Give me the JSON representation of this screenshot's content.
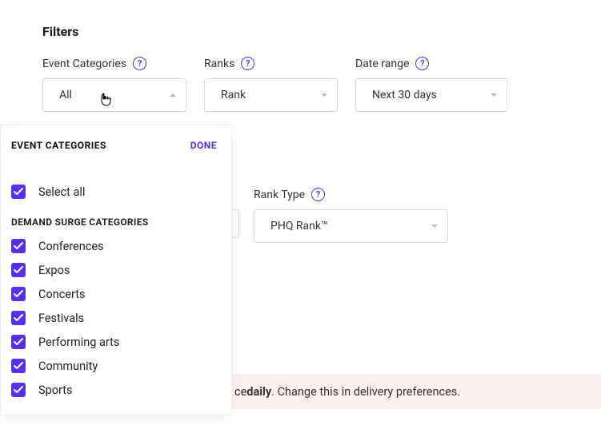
{
  "filters": {
    "title": "Filters",
    "groups": {
      "categories": {
        "label": "Event Categories",
        "value": "All"
      },
      "ranks": {
        "label": "Ranks",
        "value": "Rank"
      },
      "date": {
        "label": "Date range",
        "value": "Next 30 days"
      }
    }
  },
  "dropdown": {
    "title": "EVENT CATEGORIES",
    "done": "DONE",
    "selectAll": "Select all",
    "subhead": "DEMAND SURGE CATEGORIES",
    "items": [
      "Conferences",
      "Expos",
      "Concerts",
      "Festivals",
      "Performing arts",
      "Community",
      "Sports"
    ]
  },
  "rankType": {
    "label": "Rank Type",
    "value": "PHQ Rank™"
  },
  "banner": {
    "pre": "ce ",
    "bold": "daily",
    "post": ". Change this in delivery preferences."
  },
  "helpGlyph": "?"
}
